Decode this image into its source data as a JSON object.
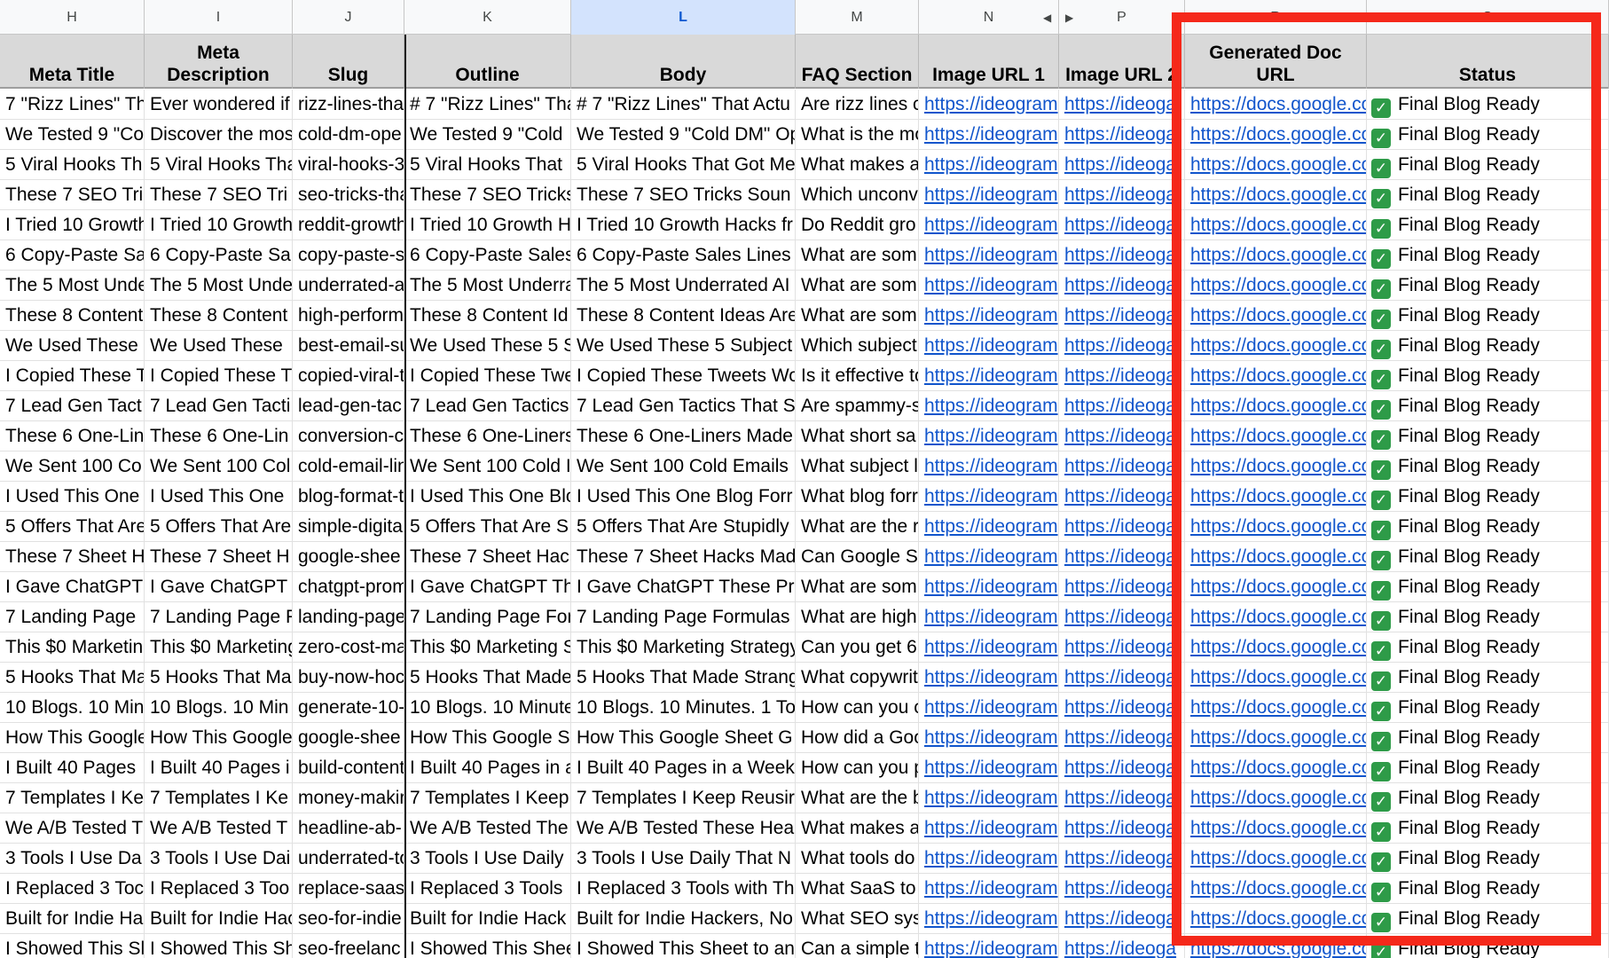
{
  "columns": {
    "letters": [
      "H",
      "I",
      "J",
      "K",
      "L",
      "M",
      "N",
      "P",
      "R",
      "S"
    ],
    "selected": "L",
    "headers": [
      "Meta Title",
      "Meta\nDescription",
      "Slug",
      "Outline",
      "Body",
      "FAQ Section",
      "Image URL 1",
      "Image URL 2",
      "Generated Doc\nURL",
      "Status"
    ]
  },
  "hidden_columns_indicator": {
    "left_arrow": "◀",
    "right_arrow": "▶"
  },
  "highlight": {
    "color": "#f5281a",
    "target": "Generated Doc URL and Status columns"
  },
  "rows": [
    [
      "7 \"Rizz Lines\" Th",
      "Ever wondered if",
      "rizz-lines-tha",
      "# 7 \"Rizz Lines\" Tha",
      "# 7 \"Rizz Lines\" That Actu",
      "Are rizz lines c",
      "https://ideogram",
      "https://ideoga",
      "https://docs.google.co",
      "Final Blog Ready"
    ],
    [
      "We Tested 9 \"Co",
      "Discover the mos",
      "cold-dm-ope",
      "We Tested 9 \"Cold",
      "We Tested 9 \"Cold DM\" Op",
      "What is the mo",
      "https://ideogram",
      "https://ideoga",
      "https://docs.google.co",
      "Final Blog Ready"
    ],
    [
      "5 Viral Hooks Th",
      "5 Viral Hooks Tha",
      "viral-hooks-3",
      "5 Viral Hooks That",
      "5 Viral Hooks That Got Me",
      "What makes a",
      "https://ideogram",
      "https://ideoga",
      "https://docs.google.co",
      "Final Blog Ready"
    ],
    [
      "These 7 SEO Tri",
      "These 7 SEO Tri",
      "seo-tricks-tha",
      "These 7 SEO Tricks",
      "These 7 SEO Tricks Soun",
      "Which unconv",
      "https://ideogram",
      "https://ideoga",
      "https://docs.google.co",
      "Final Blog Ready"
    ],
    [
      "I Tried 10 Growth",
      "I Tried 10 Growth",
      "reddit-growth",
      "I Tried 10 Growth H",
      "I Tried 10 Growth Hacks fr",
      "Do Reddit gro",
      "https://ideogram",
      "https://ideoga",
      "https://docs.google.co",
      "Final Blog Ready"
    ],
    [
      "6 Copy-Paste Sa",
      "6 Copy-Paste Sa",
      "copy-paste-s",
      "6 Copy-Paste Sales",
      "6 Copy-Paste Sales Lines",
      "What are som",
      "https://ideogram",
      "https://ideoga",
      "https://docs.google.co",
      "Final Blog Ready"
    ],
    [
      "The 5 Most Unde",
      "The 5 Most Unde",
      "underrated-a",
      "The 5 Most Underra",
      "The 5 Most Underrated AI",
      "What are som",
      "https://ideogram",
      "https://ideoga",
      "https://docs.google.co",
      "Final Blog Ready"
    ],
    [
      "These 8 Content",
      "These 8 Content",
      "high-perform",
      "These 8 Content Id",
      "These 8 Content Ideas Are",
      "What are som",
      "https://ideogram",
      "https://ideoga",
      "https://docs.google.co",
      "Final Blog Ready"
    ],
    [
      "We Used These",
      "We Used These",
      "best-email-su",
      "We Used These 5 S",
      "We Used These 5 Subject",
      "Which subject",
      "https://ideogram",
      "https://ideoga",
      "https://docs.google.co",
      "Final Blog Ready"
    ],
    [
      "I Copied These T",
      "I Copied These T",
      "copied-viral-t",
      "I Copied These Twe",
      "I Copied These Tweets Wo",
      "Is it effective to",
      "https://ideogram",
      "https://ideoga",
      "https://docs.google.co",
      "Final Blog Ready"
    ],
    [
      "7 Lead Gen Tact",
      "7 Lead Gen Tacti",
      "lead-gen-tac",
      "7 Lead Gen Tactics",
      "7 Lead Gen Tactics That S",
      "Are spammy-s",
      "https://ideogram",
      "https://ideoga",
      "https://docs.google.co",
      "Final Blog Ready"
    ],
    [
      "These 6 One-Lin",
      "These 6 One-Lin",
      "conversion-c",
      "These 6 One-Liners",
      "These 6 One-Liners Made",
      "What short sa",
      "https://ideogram",
      "https://ideoga",
      "https://docs.google.co",
      "Final Blog Ready"
    ],
    [
      "We Sent 100 Co",
      "We Sent 100 Col",
      "cold-email-lin",
      "We Sent 100 Cold I",
      "We Sent 100 Cold Emails",
      "What subject l",
      "https://ideogram",
      "https://ideoga",
      "https://docs.google.co",
      "Final Blog Ready"
    ],
    [
      "I Used This One",
      "I Used This One",
      "blog-format-t",
      "I Used This One Blo",
      "I Used This One Blog Forr",
      "What blog forr",
      "https://ideogram",
      "https://ideoga",
      "https://docs.google.co",
      "Final Blog Ready"
    ],
    [
      "5 Offers That Are",
      "5 Offers That Are",
      "simple-digita",
      "5 Offers That Are S",
      "5 Offers That Are Stupidly",
      "What are the r",
      "https://ideogram",
      "https://ideoga",
      "https://docs.google.co",
      "Final Blog Ready"
    ],
    [
      "These 7 Sheet H",
      "These 7 Sheet H",
      "google-shee",
      "These 7 Sheet Hac",
      "These 7 Sheet Hacks Mad",
      "Can Google S",
      "https://ideogram",
      "https://ideoga",
      "https://docs.google.co",
      "Final Blog Ready"
    ],
    [
      "I Gave ChatGPT",
      "I Gave ChatGPT",
      "chatgpt-prom",
      "I Gave ChatGPT Th",
      "I Gave ChatGPT These Pr",
      "What are som",
      "https://ideogram",
      "https://ideoga",
      "https://docs.google.co",
      "Final Blog Ready"
    ],
    [
      "7 Landing Page",
      "7 Landing Page F",
      "landing-page",
      "7 Landing Page For",
      "7 Landing Page Formulas",
      "What are high",
      "https://ideogram",
      "https://ideoga",
      "https://docs.google.co",
      "Final Blog Ready"
    ],
    [
      "This $0 Marketin",
      "This $0 Marketing",
      "zero-cost-ma",
      "This $0 Marketing S",
      "This $0 Marketing Strategy",
      "Can you get 6",
      "https://ideogram",
      "https://ideoga",
      "https://docs.google.co",
      "Final Blog Ready"
    ],
    [
      "5 Hooks That Ma",
      "5 Hooks That Ma",
      "buy-now-hoc",
      "5 Hooks That Made",
      "5 Hooks That Made Strang",
      "What copywrit",
      "https://ideogram",
      "https://ideoga",
      "https://docs.google.co",
      "Final Blog Ready"
    ],
    [
      "10 Blogs. 10 Min",
      "10 Blogs. 10 Min",
      "generate-10-",
      "10 Blogs. 10 Minute",
      "10 Blogs. 10 Minutes. 1 To",
      "How can you c",
      "https://ideogram",
      "https://ideoga",
      "https://docs.google.co",
      "Final Blog Ready"
    ],
    [
      "How This Google",
      "How This Google",
      "google-shee",
      "How This Google S",
      "How This Google Sheet G",
      "How did a Goo",
      "https://ideogram",
      "https://ideoga",
      "https://docs.google.co",
      "Final Blog Ready"
    ],
    [
      "I Built 40 Pages",
      "I Built 40 Pages i",
      "build-content",
      "I Built 40 Pages in a",
      "I Built 40 Pages in a Week",
      "How can you p",
      "https://ideogram",
      "https://ideoga",
      "https://docs.google.co",
      "Final Blog Ready"
    ],
    [
      "7 Templates I Ke",
      "7 Templates I Ke",
      "money-makir",
      "7 Templates I Keep",
      "7 Templates I Keep Reusir",
      "What are the b",
      "https://ideogram",
      "https://ideoga",
      "https://docs.google.co",
      "Final Blog Ready"
    ],
    [
      "We A/B Tested T",
      "We A/B Tested T",
      "headline-ab-",
      "We A/B Tested The",
      "We A/B Tested These Hea",
      "What makes a",
      "https://ideogram",
      "https://ideoga",
      "https://docs.google.co",
      "Final Blog Ready"
    ],
    [
      "3 Tools I Use Da",
      "3 Tools I Use Dai",
      "underrated-to",
      "3 Tools I Use Daily",
      "3 Tools I Use Daily That N",
      "What tools do",
      "https://ideogram",
      "https://ideoga",
      "https://docs.google.co",
      "Final Blog Ready"
    ],
    [
      "I Replaced 3 Toc",
      "I Replaced 3 Too",
      "replace-saas",
      "I Replaced 3 Tools",
      "I Replaced 3 Tools with Th",
      "What SaaS to",
      "https://ideogram",
      "https://ideoga",
      "https://docs.google.co",
      "Final Blog Ready"
    ],
    [
      "Built for Indie Ha",
      "Built for Indie Hac",
      "seo-for-indie",
      "Built for Indie Hack",
      "Built for Indie Hackers, No",
      "What SEO sys",
      "https://ideogram",
      "https://ideoga",
      "https://docs.google.co",
      "Final Blog Ready"
    ],
    [
      "I Showed This Sl",
      "I Showed This Sh",
      "seo-freelanc",
      "I Showed This Shee",
      "I Showed This Sheet to an",
      "Can a simple t",
      "https://ideogram",
      "https://ideoga",
      "https://docs.google.co",
      "Final Blog Ready"
    ]
  ]
}
